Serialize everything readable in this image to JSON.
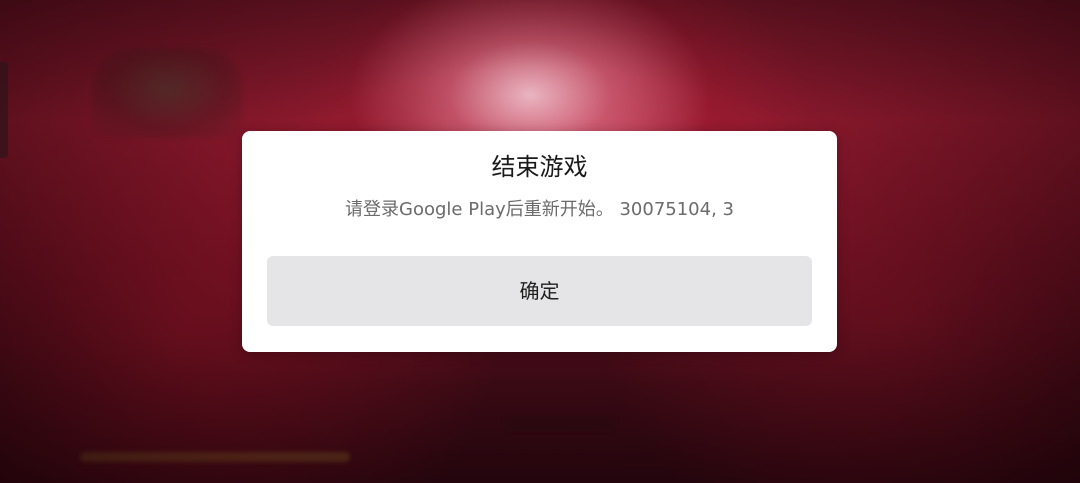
{
  "dialog": {
    "title": "结束游戏",
    "message": "请登录Google Play后重新开始。 30075104, 3",
    "confirm_label": "确定"
  },
  "colors": {
    "dialog_background": "#ffffff",
    "button_background": "#e5e5e8",
    "title_text": "#1a1a1a",
    "message_text": "#6b6b6b",
    "game_background": "#8d1a2e"
  }
}
